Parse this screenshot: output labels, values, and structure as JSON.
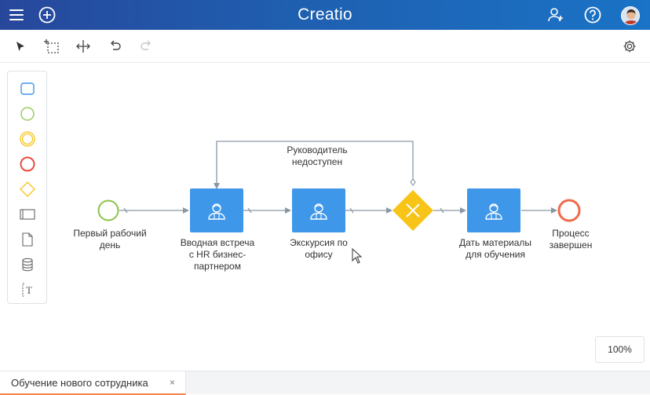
{
  "header": {
    "logo": "Creatio",
    "menu_icon": "hamburger-menu-icon",
    "add_icon": "plus-circle-icon",
    "add_user_icon": "add-user-icon",
    "help_icon": "help-icon",
    "avatar_icon": "user-avatar"
  },
  "toolbar": {
    "select_tool": "pointer-icon",
    "area_select_tool": "lasso-select-icon",
    "space_tool": "space-tool-icon",
    "undo": "undo-icon",
    "redo": "redo-icon",
    "settings": "gear-icon"
  },
  "palette": {
    "items": [
      "task-shape-icon",
      "start-event-icon",
      "intermediate-event-icon",
      "end-event-icon",
      "gateway-icon",
      "lane-icon",
      "document-icon",
      "data-store-icon",
      "annotation-icon"
    ]
  },
  "diagram": {
    "start": "Первый рабочий день",
    "task1": [
      "Вводная встреча",
      "с HR бизнес-",
      "партнером"
    ],
    "task2": [
      "Экскурсия по",
      "офису"
    ],
    "loop_label": [
      "Руководитель",
      "недоступен"
    ],
    "task3": [
      "Дать материалы",
      "для обучения"
    ],
    "end": [
      "Процесс",
      "завершен"
    ],
    "start_line1": "Первый рабочий",
    "start_line2": "день"
  },
  "zoom": "100%",
  "tabs": [
    {
      "label": "Обучение нового сотрудника",
      "close": "×"
    }
  ],
  "colors": {
    "accent": "#3e97e8",
    "gateway": "#f7c417",
    "start": "#8bc34a",
    "end": "#ef6c4a",
    "tab_accent": "#f5844c"
  }
}
